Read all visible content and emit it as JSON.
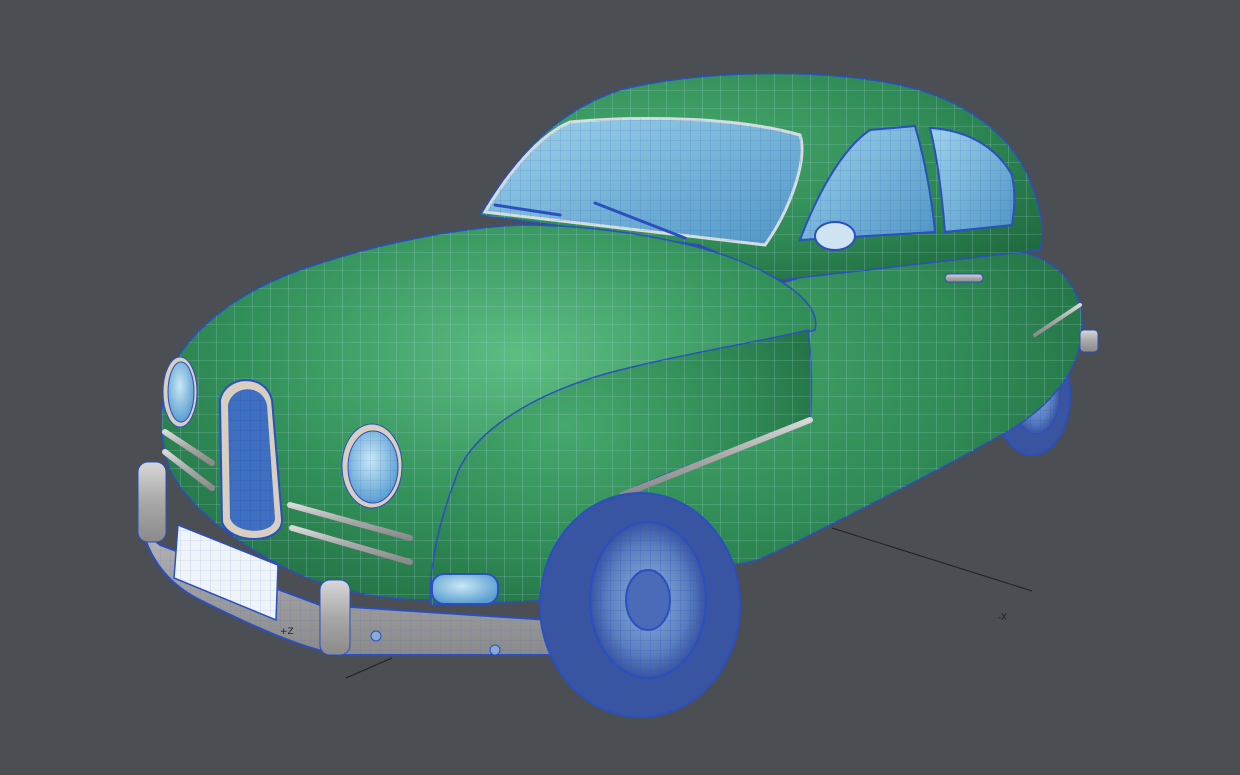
{
  "viewport": {
    "background": "#4b4e53",
    "axes": {
      "z_label": "+Z",
      "x_label": "-X"
    }
  },
  "model": {
    "subject": "car-icon",
    "body_color": "#2f8a55",
    "wire_color": "#a9d8e0",
    "edge_color": "#2a4fc0",
    "glass_color": "#6fb3d6",
    "chrome_color": "#b9b9b9"
  }
}
